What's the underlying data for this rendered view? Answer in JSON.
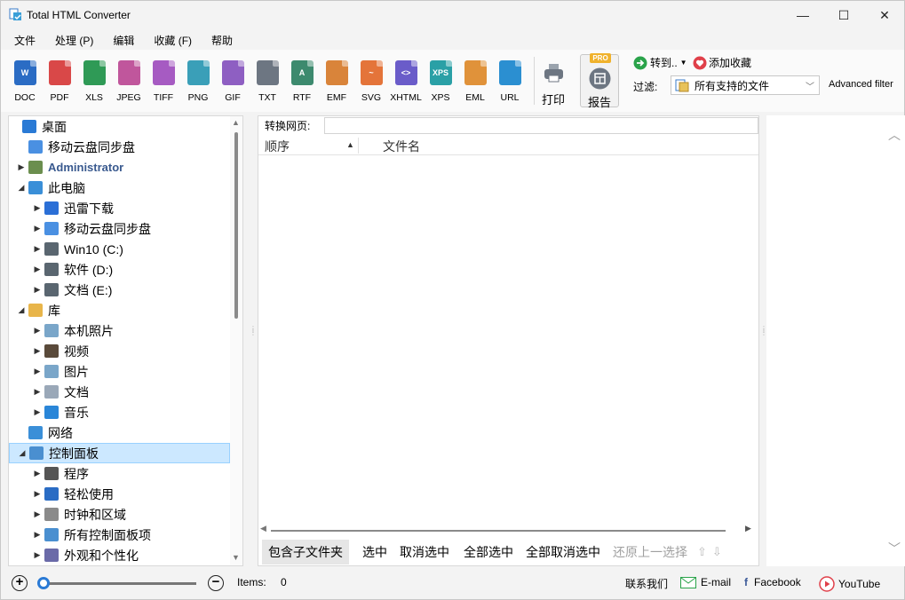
{
  "window": {
    "title": "Total HTML Converter",
    "controls": {
      "minimize": "—",
      "maximize": "☐",
      "close": "✕"
    }
  },
  "menu": [
    "文件",
    "处理 (P)",
    "编辑",
    "收藏 (F)",
    "帮助"
  ],
  "toolbar": {
    "formats": [
      {
        "label": "DOC",
        "color": "#2b6cc4",
        "glyph": "W"
      },
      {
        "label": "PDF",
        "color": "#d94848",
        "glyph": ""
      },
      {
        "label": "XLS",
        "color": "#2f9a56",
        "glyph": ""
      },
      {
        "label": "JPEG",
        "color": "#c0569c",
        "glyph": ""
      },
      {
        "label": "TIFF",
        "color": "#a65bc2",
        "glyph": ""
      },
      {
        "label": "PNG",
        "color": "#3a9fb8",
        "glyph": ""
      },
      {
        "label": "GIF",
        "color": "#8e5fc2",
        "glyph": ""
      },
      {
        "label": "TXT",
        "color": "#6d7682",
        "glyph": ""
      },
      {
        "label": "RTF",
        "color": "#3d8a6e",
        "glyph": "A"
      },
      {
        "label": "EMF",
        "color": "#d9843a",
        "glyph": ""
      },
      {
        "label": "SVG",
        "color": "#e4743a",
        "glyph": "~"
      },
      {
        "label": "XHTML",
        "color": "#6a5cc9",
        "glyph": "<>"
      },
      {
        "label": "XPS",
        "color": "#2aa0a6",
        "glyph": "XPS"
      },
      {
        "label": "EML",
        "color": "#e0923a",
        "glyph": ""
      },
      {
        "label": "URL",
        "color": "#2b8fd1",
        "glyph": ""
      }
    ],
    "print_label": "打印",
    "report_label": "报告",
    "pro_badge": "PRO",
    "goto_label": "转到..",
    "favorite_label": "添加收藏",
    "filter_label": "过滤:",
    "filter_value": "所有支持的文件",
    "advanced_filter": "Advanced filter"
  },
  "tree": [
    {
      "label": "桌面",
      "indent": 0,
      "twisty": "",
      "icon_color": "#2a7ad5",
      "icon": "desktop-icon"
    },
    {
      "label": "移动云盘同步盘",
      "indent": 1,
      "twisty": "",
      "icon_color": "#4a90e2",
      "icon": "cloud-drive-icon"
    },
    {
      "label": "Administrator",
      "indent": 1,
      "twisty": "▶",
      "icon_color": "#6b8e4e",
      "icon": "user-icon",
      "style": "bold-blue"
    },
    {
      "label": "此电脑",
      "indent": 1,
      "twisty": "◢",
      "icon_color": "#3a8fd8",
      "icon": "computer-icon"
    },
    {
      "label": "迅雷下载",
      "indent": 2,
      "twisty": "▶",
      "icon_color": "#2b6fd6",
      "icon": "thunder-icon"
    },
    {
      "label": "移动云盘同步盘",
      "indent": 2,
      "twisty": "▶",
      "icon_color": "#4a90e2",
      "icon": "cloud-drive-icon"
    },
    {
      "label": "Win10 (C:)",
      "indent": 2,
      "twisty": "▶",
      "icon_color": "#5a6670",
      "icon": "drive-icon"
    },
    {
      "label": "软件 (D:)",
      "indent": 2,
      "twisty": "▶",
      "icon_color": "#5a6670",
      "icon": "drive-icon"
    },
    {
      "label": "文档 (E:)",
      "indent": 2,
      "twisty": "▶",
      "icon_color": "#5a6670",
      "icon": "drive-icon"
    },
    {
      "label": "库",
      "indent": 1,
      "twisty": "◢",
      "icon_color": "#e8b54a",
      "icon": "library-icon"
    },
    {
      "label": "本机照片",
      "indent": 2,
      "twisty": "▶",
      "icon_color": "#7aa6c9",
      "icon": "photos-icon"
    },
    {
      "label": "视频",
      "indent": 2,
      "twisty": "▶",
      "icon_color": "#5a4a3a",
      "icon": "video-icon"
    },
    {
      "label": "图片",
      "indent": 2,
      "twisty": "▶",
      "icon_color": "#7aa6c9",
      "icon": "pictures-icon"
    },
    {
      "label": "文档",
      "indent": 2,
      "twisty": "▶",
      "icon_color": "#9aa8b8",
      "icon": "documents-icon"
    },
    {
      "label": "音乐",
      "indent": 2,
      "twisty": "▶",
      "icon_color": "#2a86d8",
      "icon": "music-icon"
    },
    {
      "label": "网络",
      "indent": 1,
      "twisty": "",
      "icon_color": "#3a8fd8",
      "icon": "network-icon"
    },
    {
      "label": "控制面板",
      "indent": 1,
      "twisty": "◢",
      "icon_color": "#4a8fd0",
      "icon": "control-panel-icon",
      "selected": true
    },
    {
      "label": "程序",
      "indent": 2,
      "twisty": "▶",
      "icon_color": "#555",
      "icon": "programs-icon"
    },
    {
      "label": "轻松使用",
      "indent": 2,
      "twisty": "▶",
      "icon_color": "#2a6cc4",
      "icon": "accessibility-icon"
    },
    {
      "label": "时钟和区域",
      "indent": 2,
      "twisty": "▶",
      "icon_color": "#8a8a8a",
      "icon": "clock-icon"
    },
    {
      "label": "所有控制面板项",
      "indent": 2,
      "twisty": "▶",
      "icon_color": "#4a8fd0",
      "icon": "control-panel-icon"
    },
    {
      "label": "外观和个性化",
      "indent": 2,
      "twisty": "▶",
      "icon_color": "#6a6aa8",
      "icon": "appearance-icon"
    }
  ],
  "center": {
    "url_label": "转换网页:",
    "url_value": "",
    "columns": [
      "顺序",
      "文件名"
    ],
    "buttons": {
      "include_subfolders": "包含子文件夹",
      "select": "选中",
      "deselect": "取消选中",
      "select_all": "全部选中",
      "deselect_all": "全部取消选中",
      "restore_prev": "还原上一选择"
    }
  },
  "status": {
    "items_label": "Items:",
    "items_count": "0",
    "zoom_level": 0,
    "contact": "联系我们",
    "email": "E-mail",
    "facebook": "Facebook",
    "youtube": "YouTube"
  }
}
